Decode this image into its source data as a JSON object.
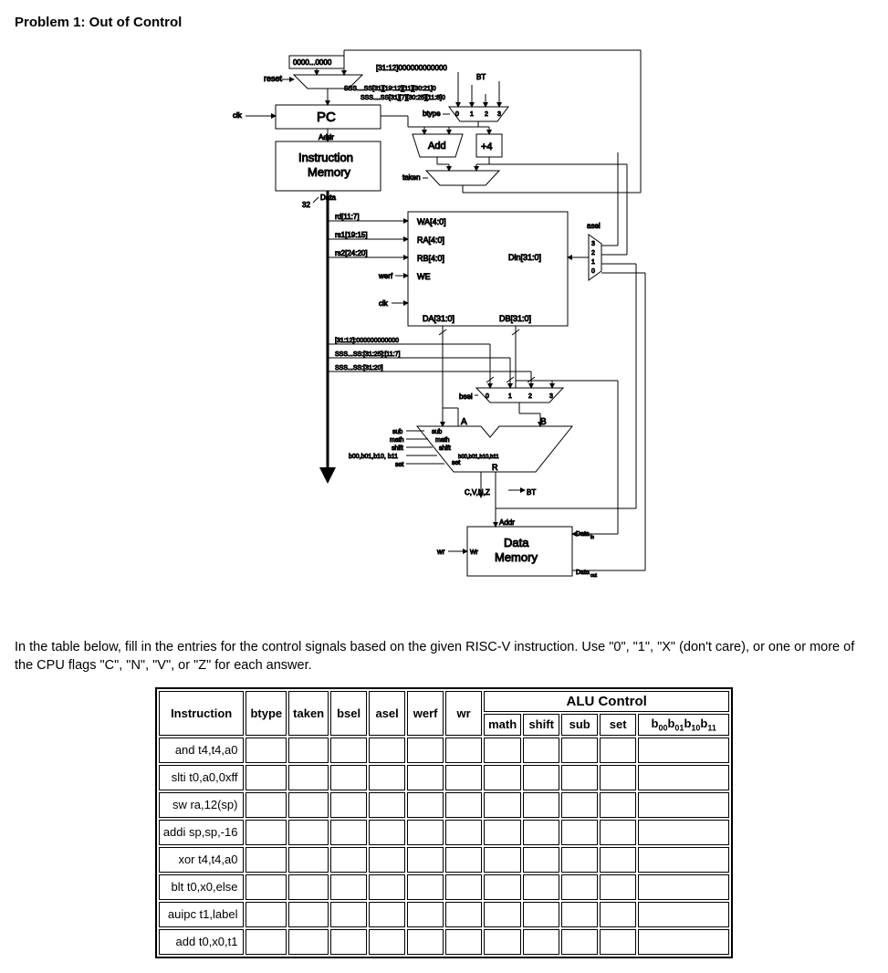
{
  "title": "Problem 1: Out of Control",
  "diagram": {
    "reset": "reset",
    "zeros": "0000...0000",
    "imm_u": "[31:12]000000000000",
    "bt": "BT",
    "imm_b": "SSS....SS[31][19:12][11][30:21]0",
    "imm_j": "SSS....SS[31][7][30:25][11:8]0",
    "clk": "clk",
    "pc": "PC",
    "btype": "btype",
    "mux_b0": "0",
    "mux_b1": "1",
    "mux_b2": "2",
    "mux_b3": "3",
    "addr": "Addr",
    "imem1": "Instruction",
    "imem2": "Memory",
    "data": "Data",
    "w32": "32",
    "add": "Add",
    "plus4": "+4",
    "taken": "taken",
    "rd": "rd[11:7]",
    "rs1": "rs1[19:15]",
    "rs2": "rs2[24:20]",
    "wa": "WA[4:0]",
    "ra": "RA[4:0]",
    "rb": "RB[4:0]",
    "we": "WE",
    "werf": "werf",
    "clk2": "clk",
    "da": "DA[31:0]",
    "db": "DB[31:0]",
    "din": "Din[31:0]",
    "asel": "asel",
    "asel3": "3",
    "asel2": "2",
    "asel1": "1",
    "asel0": "0",
    "imm_u2": "[31:12]:000000000000",
    "imm_s": "SSS...SS:[31:25]:[11:7]",
    "imm_i": "SSS...SS:[31:20]",
    "bsel": "bsel",
    "bsel0": "0",
    "bsel1": "1",
    "bsel2": "2",
    "bsel3": "3",
    "a": "A",
    "b": "B",
    "r": "R",
    "sub": "sub",
    "math": "math",
    "shift": "shift",
    "b_bits": "b00,b01,b10, b11",
    "set": "set",
    "sub2": "sub",
    "math2": "math",
    "shift2": "shift",
    "b_bits2": "b00,b01,b10,b11",
    "set2": "set",
    "cvnz": "C,V,N,Z",
    "bt2": "BT",
    "addr2": "Addr",
    "datain": "Data",
    "datain_sub": "in",
    "dmem1": "Data",
    "dmem2": "Memory",
    "dataout": "Data",
    "dataout_sub": "out",
    "wr": "wr",
    "wr2": "Wr"
  },
  "description": "In the table below, fill in the entries for the control signals based on the given RISC-V instruction. Use \"0\", \"1\", \"X\" (don't care), or one or more of the CPU flags \"C\", \"N\", \"V\", or \"Z\" for each answer.",
  "table": {
    "headers": {
      "instruction": "Instruction",
      "btype": "btype",
      "taken": "taken",
      "bsel": "bsel",
      "asel": "asel",
      "werf": "werf",
      "wr": "wr",
      "alu": "ALU Control",
      "math": "math",
      "shift": "shift",
      "sub": "sub",
      "set": "set",
      "bbits_b00": "b",
      "bbits_00": "00",
      "bbits_b01": "b",
      "bbits_01": "01",
      "bbits_b10": "b",
      "bbits_10": "10",
      "bbits_b11": "b",
      "bbits_11": "11"
    },
    "rows": [
      "and t4,t4,a0",
      "slti t0,a0,0xff",
      "sw ra,12(sp)",
      "addi sp,sp,-16",
      "xor t4,t4,a0",
      "blt t0,x0,else",
      "auipc t1,label",
      "add t0,x0,t1"
    ]
  }
}
